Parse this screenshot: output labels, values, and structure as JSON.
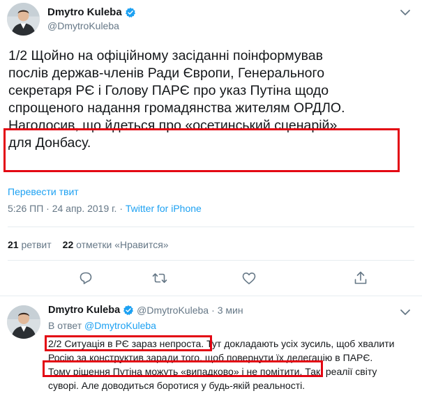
{
  "colors": {
    "highlight": "#e30613",
    "link": "#1da1f2",
    "secondary": "#657786",
    "verified": "#1da1f2"
  },
  "main_tweet": {
    "display_name": "Dmytro Kuleba",
    "handle": "@DmytroKuleba",
    "text_lines": [
      "1/2 Щойно на офіційному засіданні поінформував",
      "послів держав-членів Ради Європи, Генерального",
      "секретаря РЄ і Голову ПАРЄ про указ Путіна щодо",
      "спрощеного надання громадянства жителям ОРДЛО.",
      "Наголосив, що йдеться про «осетинський сценарій»",
      "для Донбасу."
    ],
    "translate_label": "Перевести твит",
    "timestamp": "5:26 ПП · 24 апр. 2019 г.",
    "separator": "·",
    "source": "Twitter for iPhone",
    "retweets_count": "21",
    "retweets_label": "ретвит",
    "likes_count": "22",
    "likes_label": "отметки «Нравится»"
  },
  "icons": {
    "reply": "reply-icon",
    "retweet": "retweet-icon",
    "like": "heart-icon",
    "share": "share-icon",
    "verified": "verified-badge-icon",
    "caret": "chevron-down-icon"
  },
  "reply_tweet": {
    "display_name": "Dmytro Kuleba",
    "handle": "@DmytroKuleba",
    "dot": "·",
    "time": "3 мин",
    "in_reply_prefix": "В ответ",
    "in_reply_mention": "@DmytroKuleba",
    "line1_highlight": "2/2 Ситуація в РЄ зараз непроста.",
    "line1_rest": " Тут докладають усіх зусиль, щоб хвалити",
    "line2": "Росію за конструктив заради того, щоб повернути їх делегацію в ПАРЄ.",
    "line3_highlight": "Тому рішення Путіна можуть «випадково» і не помітити.",
    "line3_rest": " Так, реалії світу",
    "line4": "суворі. Але доводиться боротися у будь-якій реальності."
  }
}
